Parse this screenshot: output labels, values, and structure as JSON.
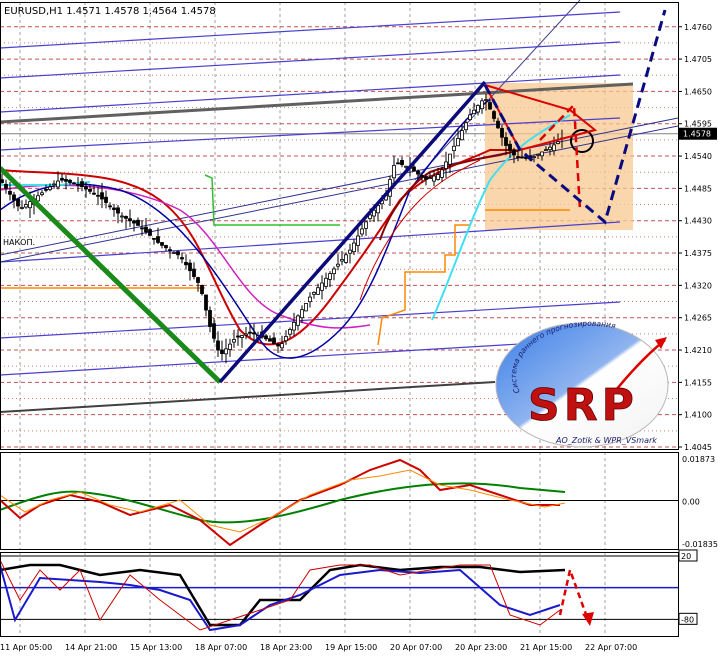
{
  "title": "EURUSD,H1  1.4571 1.4578 1.4564 1.4578",
  "current_price": "1.4578",
  "colors": {
    "background": "#ffffff",
    "grid": "#a0a0a0",
    "price_grid": "#b01818",
    "candles": "#000000",
    "channel": "#4a3fcf",
    "green_trend": "#1a8a1a",
    "navy_trend": "#0a0a7a",
    "forecast_box": "#f8c890",
    "ma_red": "#cc0000",
    "ma_magenta": "#d020c0",
    "ma_navy": "#0000a0",
    "ma_cyan": "#40e0f0",
    "ma_orange": "#ff8800",
    "ma_darkred": "#8b0000",
    "ma_green": "#30c030",
    "forecast_red": "#dd0000",
    "forecast_navy": "#0a0a80",
    "osc_green": "#008000",
    "osc_black": "#000000",
    "osc_blue": "#1a1acc"
  },
  "chart_data": [
    {
      "type": "candlestick",
      "symbol": "EURUSD",
      "timeframe": "H1",
      "ohlc_label": "1.4571 1.4578 1.4564 1.4578",
      "ylim": [
        1.4045,
        1.478
      ],
      "price_ticks": [
        "1.4760",
        "1.4705",
        "1.4650",
        "1.4595",
        "1.4540",
        "1.4485",
        "1.4430",
        "1.4375",
        "1.4320",
        "1.4265",
        "1.4210",
        "1.4155",
        "1.4100",
        "1.4045"
      ],
      "x_tick_labels": [
        "11 Apr 05:00",
        "14 Apr 21:00",
        "15 Apr 13:00",
        "18 Apr 07:00",
        "18 Apr 23:00",
        "19 Apr 15:00",
        "20 Apr 07:00",
        "20 Apr 23:00",
        "21 Apr 15:00",
        "22 Apr 07:00"
      ],
      "series_path": [
        [
          0,
          1.45
        ],
        [
          20,
          1.445
        ],
        [
          40,
          1.4475
        ],
        [
          60,
          1.45
        ],
        [
          80,
          1.449
        ],
        [
          100,
          1.447
        ],
        [
          120,
          1.444
        ],
        [
          140,
          1.442
        ],
        [
          160,
          1.439
        ],
        [
          180,
          1.437
        ],
        [
          200,
          1.432
        ],
        [
          210,
          1.425
        ],
        [
          220,
          1.42
        ],
        [
          235,
          1.423
        ],
        [
          250,
          1.424
        ],
        [
          265,
          1.423
        ],
        [
          280,
          1.4215
        ],
        [
          295,
          1.426
        ],
        [
          310,
          1.43
        ],
        [
          330,
          1.434
        ],
        [
          350,
          1.438
        ],
        [
          370,
          1.444
        ],
        [
          385,
          1.447
        ],
        [
          395,
          1.453
        ],
        [
          410,
          1.452
        ],
        [
          425,
          1.45
        ],
        [
          440,
          1.451
        ],
        [
          455,
          1.456
        ],
        [
          470,
          1.461
        ],
        [
          485,
          1.464
        ],
        [
          495,
          1.46
        ],
        [
          505,
          1.456
        ],
        [
          515,
          1.454
        ],
        [
          530,
          1.4535
        ],
        [
          545,
          1.455
        ],
        [
          555,
          1.456
        ],
        [
          565,
          1.4575
        ]
      ],
      "annotations": [
        "НАКОП."
      ]
    },
    {
      "type": "line",
      "panel": "oscillator-1",
      "ylim": [
        -0.01835,
        0.01873
      ],
      "tick_labels": [
        "0.01873",
        "0.00",
        "-0.01835"
      ]
    },
    {
      "type": "line",
      "panel": "oscillator-2",
      "ylim": [
        -100,
        20
      ],
      "tick_labels": [
        "20",
        "-80"
      ]
    }
  ],
  "logo": {
    "big_text": "SRP",
    "arc_text": "Система раннего прогнозирования",
    "sub_text": "AO_Zotik & WPR_VSmark"
  }
}
